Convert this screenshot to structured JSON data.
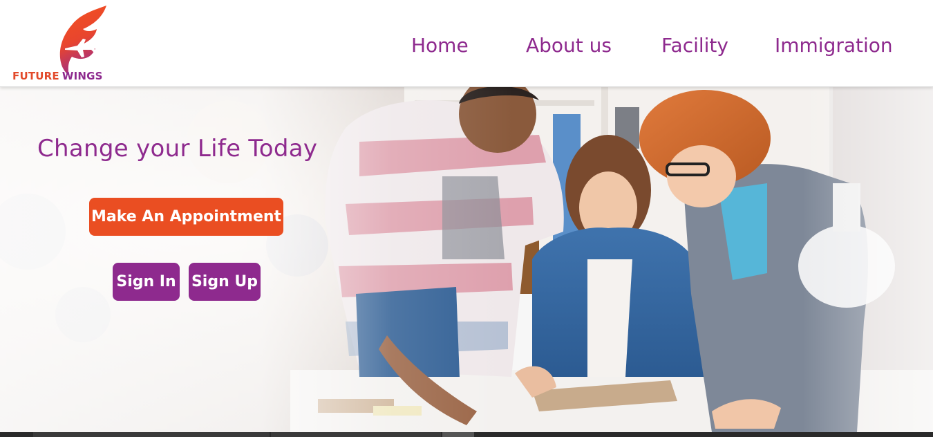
{
  "logo": {
    "word1": "FUTURE",
    "word2": "WINGS",
    "icon": "airplane-icon"
  },
  "nav": {
    "items": [
      {
        "label": "Home"
      },
      {
        "label": "About us"
      },
      {
        "label": "Facility"
      },
      {
        "label": "Immigration"
      }
    ]
  },
  "hero": {
    "tagline": "Change your Life Today",
    "appointment_label": "Make An Appointment",
    "signin_label": "Sign In",
    "signup_label": "Sign Up",
    "image": "students-studying-photo"
  },
  "colors": {
    "brand_purple": "#8e2a8e",
    "brand_orange": "#ea4e22",
    "header_bg": "#ffffff"
  }
}
